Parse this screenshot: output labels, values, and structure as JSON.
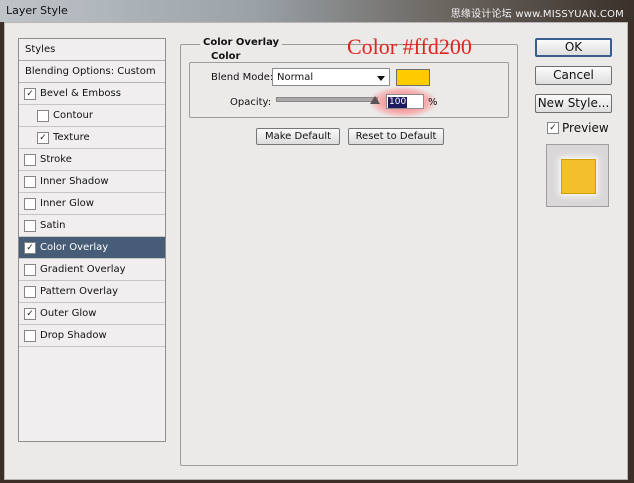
{
  "window": {
    "title": "Layer Style",
    "watermark": "思缘设计论坛 www.MISSYUAN.COM"
  },
  "styles_panel": {
    "header": "Styles",
    "blending_options": "Blending Options: Custom",
    "items": [
      {
        "label": "Bevel & Emboss",
        "checked": true,
        "sub": false,
        "selected": false
      },
      {
        "label": "Contour",
        "checked": false,
        "sub": true,
        "selected": false
      },
      {
        "label": "Texture",
        "checked": true,
        "sub": true,
        "selected": false
      },
      {
        "label": "Stroke",
        "checked": false,
        "sub": false,
        "selected": false
      },
      {
        "label": "Inner Shadow",
        "checked": false,
        "sub": false,
        "selected": false
      },
      {
        "label": "Inner Glow",
        "checked": false,
        "sub": false,
        "selected": false
      },
      {
        "label": "Satin",
        "checked": false,
        "sub": false,
        "selected": false
      },
      {
        "label": "Color Overlay",
        "checked": true,
        "sub": false,
        "selected": true
      },
      {
        "label": "Gradient Overlay",
        "checked": false,
        "sub": false,
        "selected": false
      },
      {
        "label": "Pattern Overlay",
        "checked": false,
        "sub": false,
        "selected": false
      },
      {
        "label": "Outer Glow",
        "checked": true,
        "sub": false,
        "selected": false
      },
      {
        "label": "Drop Shadow",
        "checked": false,
        "sub": false,
        "selected": false
      }
    ]
  },
  "color_overlay": {
    "group_title": "Color Overlay",
    "subgroup_title": "Color",
    "blend_mode_label": "Blend Mode:",
    "blend_mode_value": "Normal",
    "overlay_color": "#ffcc00",
    "opacity_label": "Opacity:",
    "opacity_value": "100",
    "opacity_unit": "%",
    "opacity_level": 1.0,
    "make_default": "Make Default",
    "reset_to_default": "Reset to Default"
  },
  "annotation": "Color #ffd200",
  "buttons": {
    "ok": "OK",
    "cancel": "Cancel",
    "new_style": "New Style..."
  },
  "preview": {
    "label": "Preview",
    "checked": true,
    "swatch_color": "#f2c02a"
  },
  "colors": {
    "selected_row": "#475c76",
    "annotation": "#e0241f"
  }
}
